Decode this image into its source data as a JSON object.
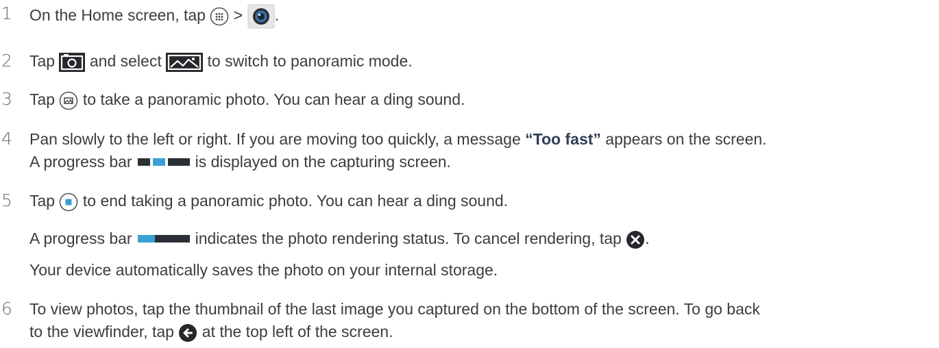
{
  "steps": [
    {
      "number": "1",
      "text_before": "On the Home screen, tap",
      "separator": ">",
      "text_after": ".",
      "icons": [
        "apps-grid-icon",
        "camera-app-icon"
      ]
    },
    {
      "number": "2",
      "text_a": "Tap",
      "text_b": "and select",
      "text_c": "to switch to panoramic mode.",
      "icons": [
        "camera-mode-icon",
        "panorama-mode-icon"
      ]
    },
    {
      "number": "3",
      "text_a": "Tap",
      "text_b": "to take a panoramic photo. You can hear a ding sound.",
      "icons": [
        "panorama-shutter-icon"
      ]
    },
    {
      "number": "4",
      "line1_before": "Pan slowly to the left or right. If you are moving too quickly, a message",
      "bold": "“Too fast”",
      "line1_after": "appears on the screen.",
      "line2_before": "A progress bar",
      "line2_after": "is displayed on the capturing screen.",
      "icons": [
        "capturing-progress-bar"
      ]
    },
    {
      "number": "5",
      "line1_a": "Tap",
      "line1_b": "to end taking a panoramic photo. You can hear a ding sound.",
      "line2_before": "A progress bar",
      "line2_after": "indicates the photo rendering status. To cancel rendering, tap",
      "line2_end": ".",
      "line3": "Your device automatically saves the photo on your internal storage.",
      "icons": [
        "stop-capture-icon",
        "rendering-progress-bar",
        "cancel-icon"
      ]
    },
    {
      "number": "6",
      "line1": "To view photos, tap the thumbnail of the last image you captured on the bottom of the screen. To go back",
      "line2_before": "to the viewfinder, tap",
      "line2_after": "at the top left of the screen.",
      "icons": [
        "back-arrow-icon"
      ]
    }
  ],
  "colors": {
    "text": "#3c3c3c",
    "step_number": "#6b6b6b",
    "bold_text": "#2e3d57",
    "progress_blue": "#3aa0d2",
    "progress_dark": "#2b3036",
    "icon_dark": "#26282c"
  },
  "progress": {
    "capturing_fraction": 0.3,
    "rendering_fraction": 0.33
  }
}
